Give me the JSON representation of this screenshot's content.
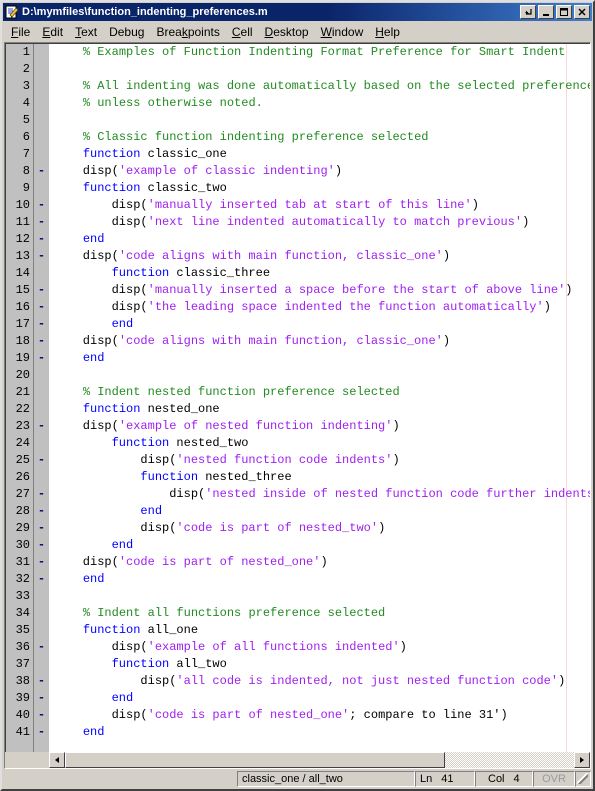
{
  "window": {
    "title": "D:\\mymfiles\\function_indenting_preferences.m",
    "icon": "matlab-editor-document-icon",
    "buttons": [
      {
        "name": "undock-button",
        "glyph": "undock"
      },
      {
        "name": "minimize-button",
        "glyph": "minimize"
      },
      {
        "name": "maximize-button",
        "glyph": "maximize"
      },
      {
        "name": "close-button",
        "glyph": "close"
      }
    ]
  },
  "menubar": {
    "items": [
      {
        "label": "File",
        "accel": "F"
      },
      {
        "label": "Edit",
        "accel": "E"
      },
      {
        "label": "Text",
        "accel": "T"
      },
      {
        "label": "Debug",
        "accel": "g"
      },
      {
        "label": "Breakpoints",
        "accel": "k"
      },
      {
        "label": "Cell",
        "accel": "C"
      },
      {
        "label": "Desktop",
        "accel": "D"
      },
      {
        "label": "Window",
        "accel": "W"
      },
      {
        "label": "Help",
        "accel": "H"
      }
    ]
  },
  "editor": {
    "colors": {
      "keyword": "#0000ff",
      "string": "#a020f0",
      "comment": "#228b22",
      "plain": "#000000",
      "background": "#ffffff",
      "gutter": "#c0c0c0",
      "column_marker": "#ffd6d6"
    },
    "lines": [
      {
        "n": 1,
        "bp": "",
        "tokens": [
          {
            "t": "pln",
            "v": "    "
          },
          {
            "t": "cmt",
            "v": "% Examples of Function Indenting Format Preference for Smart Indent"
          }
        ]
      },
      {
        "n": 2,
        "bp": "",
        "tokens": []
      },
      {
        "n": 3,
        "bp": "",
        "tokens": [
          {
            "t": "pln",
            "v": "    "
          },
          {
            "t": "cmt",
            "v": "% All indenting was done automatically based on the selected preference,"
          }
        ]
      },
      {
        "n": 4,
        "bp": "",
        "tokens": [
          {
            "t": "pln",
            "v": "    "
          },
          {
            "t": "cmt",
            "v": "% unless otherwise noted."
          }
        ]
      },
      {
        "n": 5,
        "bp": "",
        "tokens": []
      },
      {
        "n": 6,
        "bp": "",
        "tokens": [
          {
            "t": "pln",
            "v": "    "
          },
          {
            "t": "cmt",
            "v": "% Classic function indenting preference selected"
          }
        ]
      },
      {
        "n": 7,
        "bp": "",
        "tokens": [
          {
            "t": "pln",
            "v": "    "
          },
          {
            "t": "kw",
            "v": "function"
          },
          {
            "t": "pln",
            "v": " classic_one"
          }
        ]
      },
      {
        "n": 8,
        "bp": "-",
        "tokens": [
          {
            "t": "pln",
            "v": "    disp("
          },
          {
            "t": "str",
            "v": "'example of classic indenting'"
          },
          {
            "t": "pln",
            "v": ")"
          }
        ]
      },
      {
        "n": 9,
        "bp": "",
        "tokens": [
          {
            "t": "pln",
            "v": "    "
          },
          {
            "t": "kw",
            "v": "function"
          },
          {
            "t": "pln",
            "v": " classic_two"
          }
        ]
      },
      {
        "n": 10,
        "bp": "-",
        "tokens": [
          {
            "t": "pln",
            "v": "        disp("
          },
          {
            "t": "str",
            "v": "'manually inserted tab at start of this line'"
          },
          {
            "t": "pln",
            "v": ")"
          }
        ]
      },
      {
        "n": 11,
        "bp": "-",
        "tokens": [
          {
            "t": "pln",
            "v": "        disp("
          },
          {
            "t": "str",
            "v": "'next line indented automatically to match previous'"
          },
          {
            "t": "pln",
            "v": ")"
          }
        ]
      },
      {
        "n": 12,
        "bp": "-",
        "tokens": [
          {
            "t": "pln",
            "v": "    "
          },
          {
            "t": "kw",
            "v": "end"
          }
        ]
      },
      {
        "n": 13,
        "bp": "-",
        "tokens": [
          {
            "t": "pln",
            "v": "    disp("
          },
          {
            "t": "str",
            "v": "'code aligns with main function, classic_one'"
          },
          {
            "t": "pln",
            "v": ")"
          }
        ]
      },
      {
        "n": 14,
        "bp": "",
        "tokens": [
          {
            "t": "pln",
            "v": "        "
          },
          {
            "t": "kw",
            "v": "function"
          },
          {
            "t": "pln",
            "v": " classic_three"
          }
        ]
      },
      {
        "n": 15,
        "bp": "-",
        "tokens": [
          {
            "t": "pln",
            "v": "        disp("
          },
          {
            "t": "str",
            "v": "'manually inserted a space before the start of above line'"
          },
          {
            "t": "pln",
            "v": ")"
          }
        ]
      },
      {
        "n": 16,
        "bp": "-",
        "tokens": [
          {
            "t": "pln",
            "v": "        disp("
          },
          {
            "t": "str",
            "v": "'the leading space indented the function automatically'"
          },
          {
            "t": "pln",
            "v": ")"
          }
        ]
      },
      {
        "n": 17,
        "bp": "-",
        "tokens": [
          {
            "t": "pln",
            "v": "        "
          },
          {
            "t": "kw",
            "v": "end"
          }
        ]
      },
      {
        "n": 18,
        "bp": "-",
        "tokens": [
          {
            "t": "pln",
            "v": "    disp("
          },
          {
            "t": "str",
            "v": "'code aligns with main function, classic_one'"
          },
          {
            "t": "pln",
            "v": ")"
          }
        ]
      },
      {
        "n": 19,
        "bp": "-",
        "tokens": [
          {
            "t": "pln",
            "v": "    "
          },
          {
            "t": "kw",
            "v": "end"
          }
        ]
      },
      {
        "n": 20,
        "bp": "",
        "tokens": []
      },
      {
        "n": 21,
        "bp": "",
        "tokens": [
          {
            "t": "pln",
            "v": "    "
          },
          {
            "t": "cmt",
            "v": "% Indent nested function preference selected"
          }
        ]
      },
      {
        "n": 22,
        "bp": "",
        "tokens": [
          {
            "t": "pln",
            "v": "    "
          },
          {
            "t": "kw",
            "v": "function"
          },
          {
            "t": "pln",
            "v": " nested_one"
          }
        ]
      },
      {
        "n": 23,
        "bp": "-",
        "tokens": [
          {
            "t": "pln",
            "v": "    disp("
          },
          {
            "t": "str",
            "v": "'example of nested function indenting'"
          },
          {
            "t": "pln",
            "v": ")"
          }
        ]
      },
      {
        "n": 24,
        "bp": "",
        "tokens": [
          {
            "t": "pln",
            "v": "        "
          },
          {
            "t": "kw",
            "v": "function"
          },
          {
            "t": "pln",
            "v": " nested_two"
          }
        ]
      },
      {
        "n": 25,
        "bp": "-",
        "tokens": [
          {
            "t": "pln",
            "v": "            disp("
          },
          {
            "t": "str",
            "v": "'nested function code indents'"
          },
          {
            "t": "pln",
            "v": ")"
          }
        ]
      },
      {
        "n": 26,
        "bp": "",
        "tokens": [
          {
            "t": "pln",
            "v": "            "
          },
          {
            "t": "kw",
            "v": "function"
          },
          {
            "t": "pln",
            "v": " nested_three"
          }
        ]
      },
      {
        "n": 27,
        "bp": "-",
        "tokens": [
          {
            "t": "pln",
            "v": "                disp("
          },
          {
            "t": "str",
            "v": "'nested inside of nested function code further indents'"
          },
          {
            "t": "pln",
            "v": ")"
          }
        ]
      },
      {
        "n": 28,
        "bp": "-",
        "tokens": [
          {
            "t": "pln",
            "v": "            "
          },
          {
            "t": "kw",
            "v": "end"
          }
        ]
      },
      {
        "n": 29,
        "bp": "-",
        "tokens": [
          {
            "t": "pln",
            "v": "            disp("
          },
          {
            "t": "str",
            "v": "'code is part of nested_two'"
          },
          {
            "t": "pln",
            "v": ")"
          }
        ]
      },
      {
        "n": 30,
        "bp": "-",
        "tokens": [
          {
            "t": "pln",
            "v": "        "
          },
          {
            "t": "kw",
            "v": "end"
          }
        ]
      },
      {
        "n": 31,
        "bp": "-",
        "tokens": [
          {
            "t": "pln",
            "v": "    disp("
          },
          {
            "t": "str",
            "v": "'code is part of nested_one'"
          },
          {
            "t": "pln",
            "v": ")"
          }
        ]
      },
      {
        "n": 32,
        "bp": "-",
        "tokens": [
          {
            "t": "pln",
            "v": "    "
          },
          {
            "t": "kw",
            "v": "end"
          }
        ]
      },
      {
        "n": 33,
        "bp": "",
        "tokens": []
      },
      {
        "n": 34,
        "bp": "",
        "tokens": [
          {
            "t": "pln",
            "v": "    "
          },
          {
            "t": "cmt",
            "v": "% Indent all functions preference selected"
          }
        ]
      },
      {
        "n": 35,
        "bp": "",
        "tokens": [
          {
            "t": "pln",
            "v": "    "
          },
          {
            "t": "kw",
            "v": "function"
          },
          {
            "t": "pln",
            "v": " all_one"
          }
        ]
      },
      {
        "n": 36,
        "bp": "-",
        "tokens": [
          {
            "t": "pln",
            "v": "        disp("
          },
          {
            "t": "str",
            "v": "'example of all functions indented'"
          },
          {
            "t": "pln",
            "v": ")"
          }
        ]
      },
      {
        "n": 37,
        "bp": "",
        "tokens": [
          {
            "t": "pln",
            "v": "        "
          },
          {
            "t": "kw",
            "v": "function"
          },
          {
            "t": "pln",
            "v": " all_two"
          }
        ]
      },
      {
        "n": 38,
        "bp": "-",
        "tokens": [
          {
            "t": "pln",
            "v": "            disp("
          },
          {
            "t": "str",
            "v": "'all code is indented, not just nested function code'"
          },
          {
            "t": "pln",
            "v": ")"
          }
        ]
      },
      {
        "n": 39,
        "bp": "-",
        "tokens": [
          {
            "t": "pln",
            "v": "        "
          },
          {
            "t": "kw",
            "v": "end"
          }
        ]
      },
      {
        "n": 40,
        "bp": "-",
        "tokens": [
          {
            "t": "pln",
            "v": "        disp("
          },
          {
            "t": "str",
            "v": "'code is part of nested_one'"
          },
          {
            "t": "pln",
            "v": "; compare to line 31')"
          }
        ]
      },
      {
        "n": 41,
        "bp": "-",
        "tokens": [
          {
            "t": "pln",
            "v": "    "
          },
          {
            "t": "kw",
            "v": "end"
          }
        ]
      }
    ]
  },
  "hscrollbar": {
    "left_arrow": "◀",
    "right_arrow": "▶"
  },
  "statusbar": {
    "function_path": "classic_one / all_two",
    "line_label": "Ln",
    "line_value": "41",
    "col_label": "Col",
    "col_value": "4",
    "overwrite_label": "OVR"
  }
}
